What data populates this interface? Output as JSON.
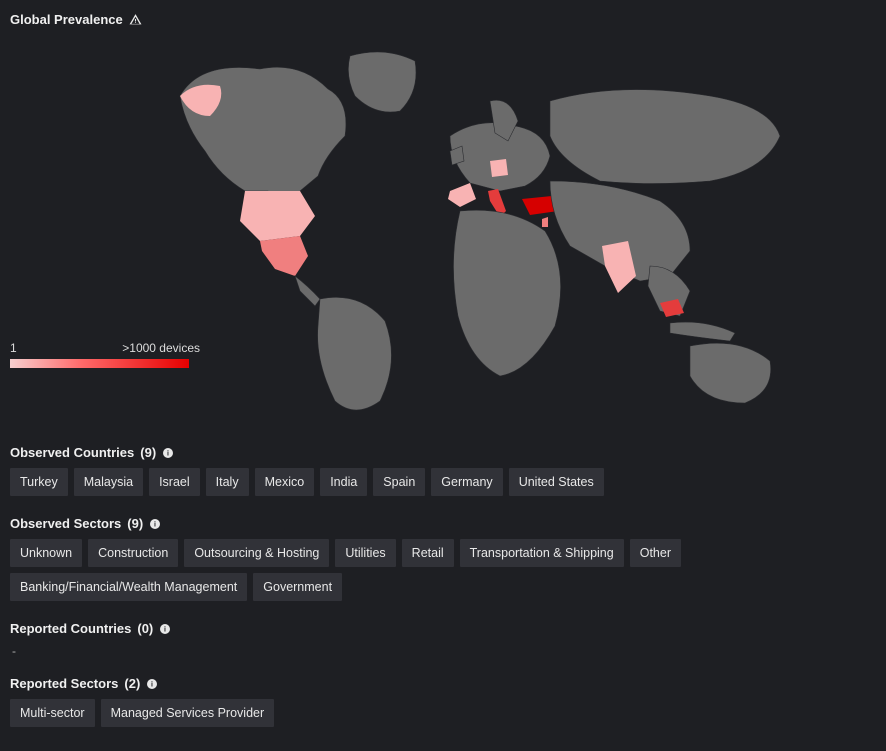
{
  "header": {
    "title": "Global Prevalence",
    "warn_icon": "warning-triangle"
  },
  "legend": {
    "min_label": "1",
    "max_label": ">1000 devices"
  },
  "map": {
    "highlighted_countries": [
      {
        "name": "United States",
        "intensity": 1
      },
      {
        "name": "Mexico",
        "intensity": 2
      },
      {
        "name": "Spain",
        "intensity": 1
      },
      {
        "name": "Italy",
        "intensity": 3
      },
      {
        "name": "Germany",
        "intensity": 1
      },
      {
        "name": "Turkey",
        "intensity": 4
      },
      {
        "name": "Israel",
        "intensity": 2
      },
      {
        "name": "India",
        "intensity": 1
      },
      {
        "name": "Malaysia",
        "intensity": 3
      }
    ]
  },
  "observed_countries": {
    "title": "Observed Countries",
    "count": "9",
    "items": [
      "Turkey",
      "Malaysia",
      "Israel",
      "Italy",
      "Mexico",
      "India",
      "Spain",
      "Germany",
      "United States"
    ]
  },
  "observed_sectors": {
    "title": "Observed Sectors",
    "count": "9",
    "items": [
      "Unknown",
      "Construction",
      "Outsourcing & Hosting",
      "Utilities",
      "Retail",
      "Transportation & Shipping",
      "Other",
      "Banking/Financial/Wealth Management",
      "Government"
    ]
  },
  "reported_countries": {
    "title": "Reported Countries",
    "count": "0",
    "empty_marker": "-"
  },
  "reported_sectors": {
    "title": "Reported Sectors",
    "count": "2",
    "items": [
      "Multi-sector",
      "Managed Services Provider"
    ]
  }
}
